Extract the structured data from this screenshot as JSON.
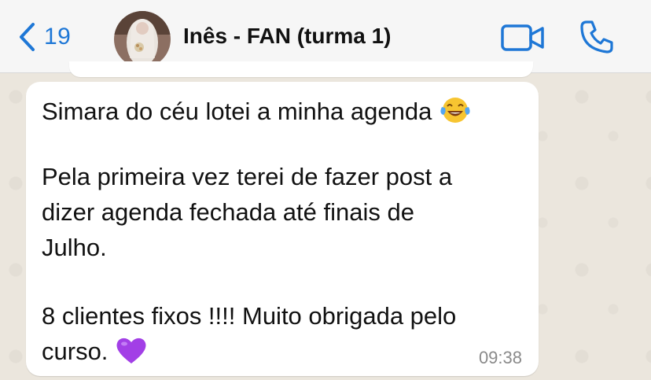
{
  "header": {
    "back_count": "19",
    "contact_name": "Inês - FAN (turma 1)"
  },
  "message": {
    "lines": [
      "Simara do céu lotei a minha agenda",
      "Pela primeira vez terei de fazer post a",
      "dizer agenda fechada até finais de",
      "Julho.",
      "8 clientes fixos !!!! Muito obrigada pelo",
      "curso."
    ],
    "time": "09:38"
  },
  "icons": {
    "back": "chevron-left-icon",
    "video": "video-camera-icon",
    "phone": "phone-icon",
    "emoji_1": "tears-of-joy-emoji",
    "emoji_2": "purple-heart-emoji"
  },
  "colors": {
    "accent": "#1e77d6",
    "bubble": "#ffffff",
    "chat_background": "#ebe6dd",
    "heart": "#a23fe6"
  }
}
